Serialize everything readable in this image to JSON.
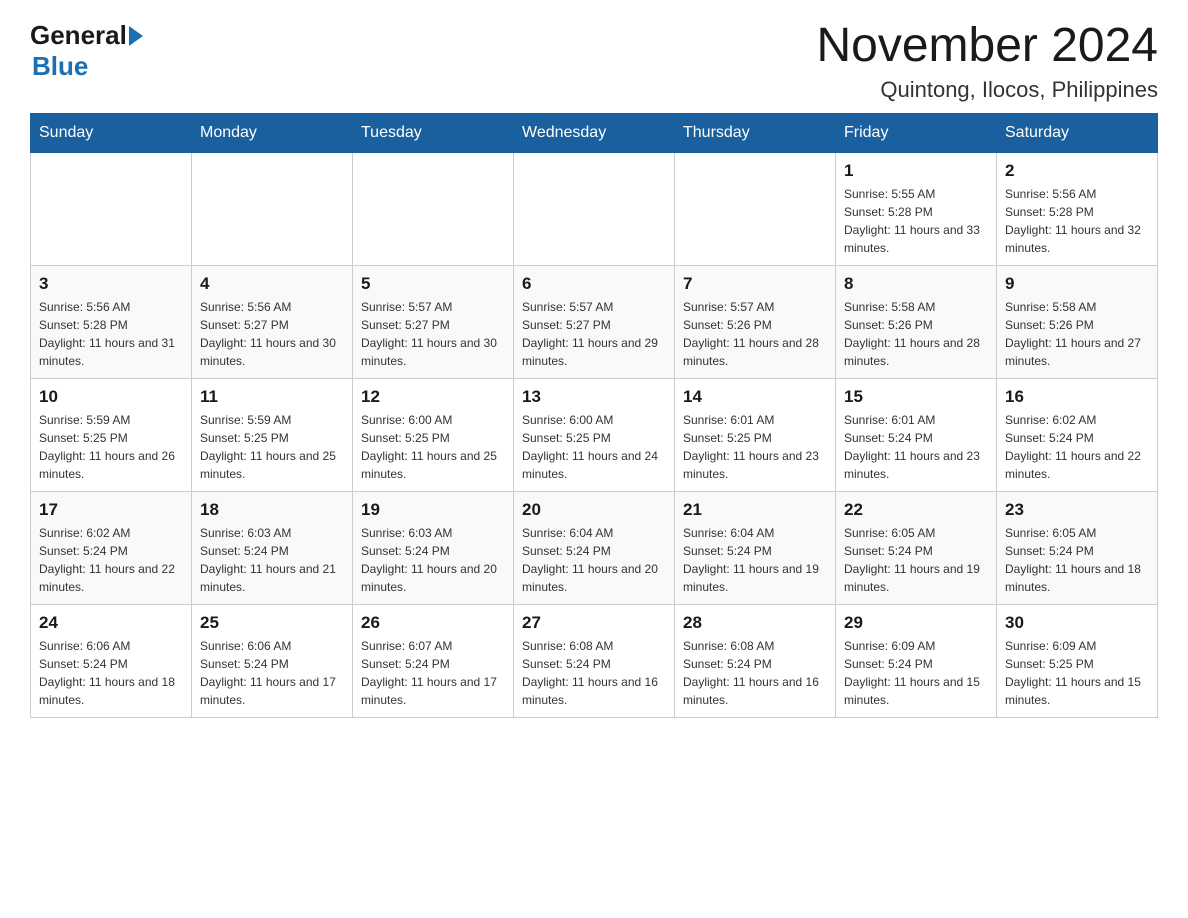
{
  "header": {
    "logo": {
      "line1": "General",
      "arrow": true,
      "line2": "Blue"
    },
    "title": "November 2024",
    "subtitle": "Quintong, Ilocos, Philippines"
  },
  "calendar": {
    "weekdays": [
      "Sunday",
      "Monday",
      "Tuesday",
      "Wednesday",
      "Thursday",
      "Friday",
      "Saturday"
    ],
    "weeks": [
      [
        {
          "day": "",
          "info": ""
        },
        {
          "day": "",
          "info": ""
        },
        {
          "day": "",
          "info": ""
        },
        {
          "day": "",
          "info": ""
        },
        {
          "day": "",
          "info": ""
        },
        {
          "day": "1",
          "info": "Sunrise: 5:55 AM\nSunset: 5:28 PM\nDaylight: 11 hours and 33 minutes."
        },
        {
          "day": "2",
          "info": "Sunrise: 5:56 AM\nSunset: 5:28 PM\nDaylight: 11 hours and 32 minutes."
        }
      ],
      [
        {
          "day": "3",
          "info": "Sunrise: 5:56 AM\nSunset: 5:28 PM\nDaylight: 11 hours and 31 minutes."
        },
        {
          "day": "4",
          "info": "Sunrise: 5:56 AM\nSunset: 5:27 PM\nDaylight: 11 hours and 30 minutes."
        },
        {
          "day": "5",
          "info": "Sunrise: 5:57 AM\nSunset: 5:27 PM\nDaylight: 11 hours and 30 minutes."
        },
        {
          "day": "6",
          "info": "Sunrise: 5:57 AM\nSunset: 5:27 PM\nDaylight: 11 hours and 29 minutes."
        },
        {
          "day": "7",
          "info": "Sunrise: 5:57 AM\nSunset: 5:26 PM\nDaylight: 11 hours and 28 minutes."
        },
        {
          "day": "8",
          "info": "Sunrise: 5:58 AM\nSunset: 5:26 PM\nDaylight: 11 hours and 28 minutes."
        },
        {
          "day": "9",
          "info": "Sunrise: 5:58 AM\nSunset: 5:26 PM\nDaylight: 11 hours and 27 minutes."
        }
      ],
      [
        {
          "day": "10",
          "info": "Sunrise: 5:59 AM\nSunset: 5:25 PM\nDaylight: 11 hours and 26 minutes."
        },
        {
          "day": "11",
          "info": "Sunrise: 5:59 AM\nSunset: 5:25 PM\nDaylight: 11 hours and 25 minutes."
        },
        {
          "day": "12",
          "info": "Sunrise: 6:00 AM\nSunset: 5:25 PM\nDaylight: 11 hours and 25 minutes."
        },
        {
          "day": "13",
          "info": "Sunrise: 6:00 AM\nSunset: 5:25 PM\nDaylight: 11 hours and 24 minutes."
        },
        {
          "day": "14",
          "info": "Sunrise: 6:01 AM\nSunset: 5:25 PM\nDaylight: 11 hours and 23 minutes."
        },
        {
          "day": "15",
          "info": "Sunrise: 6:01 AM\nSunset: 5:24 PM\nDaylight: 11 hours and 23 minutes."
        },
        {
          "day": "16",
          "info": "Sunrise: 6:02 AM\nSunset: 5:24 PM\nDaylight: 11 hours and 22 minutes."
        }
      ],
      [
        {
          "day": "17",
          "info": "Sunrise: 6:02 AM\nSunset: 5:24 PM\nDaylight: 11 hours and 22 minutes."
        },
        {
          "day": "18",
          "info": "Sunrise: 6:03 AM\nSunset: 5:24 PM\nDaylight: 11 hours and 21 minutes."
        },
        {
          "day": "19",
          "info": "Sunrise: 6:03 AM\nSunset: 5:24 PM\nDaylight: 11 hours and 20 minutes."
        },
        {
          "day": "20",
          "info": "Sunrise: 6:04 AM\nSunset: 5:24 PM\nDaylight: 11 hours and 20 minutes."
        },
        {
          "day": "21",
          "info": "Sunrise: 6:04 AM\nSunset: 5:24 PM\nDaylight: 11 hours and 19 minutes."
        },
        {
          "day": "22",
          "info": "Sunrise: 6:05 AM\nSunset: 5:24 PM\nDaylight: 11 hours and 19 minutes."
        },
        {
          "day": "23",
          "info": "Sunrise: 6:05 AM\nSunset: 5:24 PM\nDaylight: 11 hours and 18 minutes."
        }
      ],
      [
        {
          "day": "24",
          "info": "Sunrise: 6:06 AM\nSunset: 5:24 PM\nDaylight: 11 hours and 18 minutes."
        },
        {
          "day": "25",
          "info": "Sunrise: 6:06 AM\nSunset: 5:24 PM\nDaylight: 11 hours and 17 minutes."
        },
        {
          "day": "26",
          "info": "Sunrise: 6:07 AM\nSunset: 5:24 PM\nDaylight: 11 hours and 17 minutes."
        },
        {
          "day": "27",
          "info": "Sunrise: 6:08 AM\nSunset: 5:24 PM\nDaylight: 11 hours and 16 minutes."
        },
        {
          "day": "28",
          "info": "Sunrise: 6:08 AM\nSunset: 5:24 PM\nDaylight: 11 hours and 16 minutes."
        },
        {
          "day": "29",
          "info": "Sunrise: 6:09 AM\nSunset: 5:24 PM\nDaylight: 11 hours and 15 minutes."
        },
        {
          "day": "30",
          "info": "Sunrise: 6:09 AM\nSunset: 5:25 PM\nDaylight: 11 hours and 15 minutes."
        }
      ]
    ]
  }
}
